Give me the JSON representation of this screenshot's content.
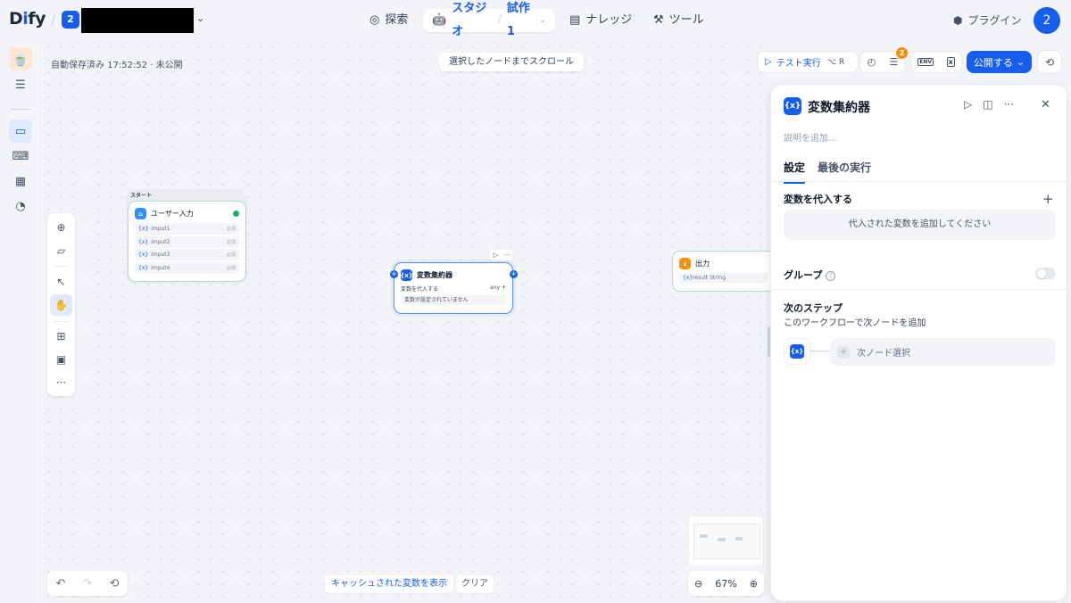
{
  "nav": {
    "logo_prefix": "D",
    "logo_i": "i",
    "logo_suffix": "fy",
    "workspace_badge": "2",
    "explore": "探索",
    "studio": "スタジオ",
    "app_name": "試作1",
    "knowledge": "ナレッジ",
    "tools": "ツール",
    "plugins": "プラグイン",
    "avatar": "2"
  },
  "canvas": {
    "autosave": "自動保存済み 17:52:52 · 未公開",
    "scroll_to_node": "選択したノードまでスクロール",
    "cached_vars": "キャッシュされた変数を表示",
    "clear": "クリア",
    "zoom": "67%"
  },
  "nodes": {
    "start_group_label": "スタート",
    "start_title": "ユーザー入力",
    "start_vars": [
      {
        "name": "imput1",
        "req": "必須"
      },
      {
        "name": "imput2",
        "req": "必須"
      },
      {
        "name": "imput3",
        "req": "必須"
      },
      {
        "name": "imput4",
        "req": "必須"
      }
    ],
    "agg_title": "変数集約器",
    "agg_assign": "変数を代入する",
    "agg_type": "any",
    "agg_empty": "変数が設定されていません",
    "output_title": "出力",
    "output_var": "result",
    "output_type": "String"
  },
  "header": {
    "test_run": "テスト実行",
    "test_shortcut": "⌥ R",
    "badge": "2",
    "env": "ENV",
    "publish": "公開する"
  },
  "panel": {
    "title": "変数集約器",
    "desc_placeholder": "説明を追加...",
    "tab_settings": "設定",
    "tab_last_run": "最後の実行",
    "assign_section": "変数を代入する",
    "assign_empty": "代入された変数を追加してください",
    "group": "グループ",
    "next_step": "次のステップ",
    "next_step_sub": "このワークフローで次ノードを追加",
    "next_select": "次ノード選択"
  },
  "colors": {
    "accent": "#155eef",
    "success": "#17b26a",
    "warning": "#f79009"
  }
}
